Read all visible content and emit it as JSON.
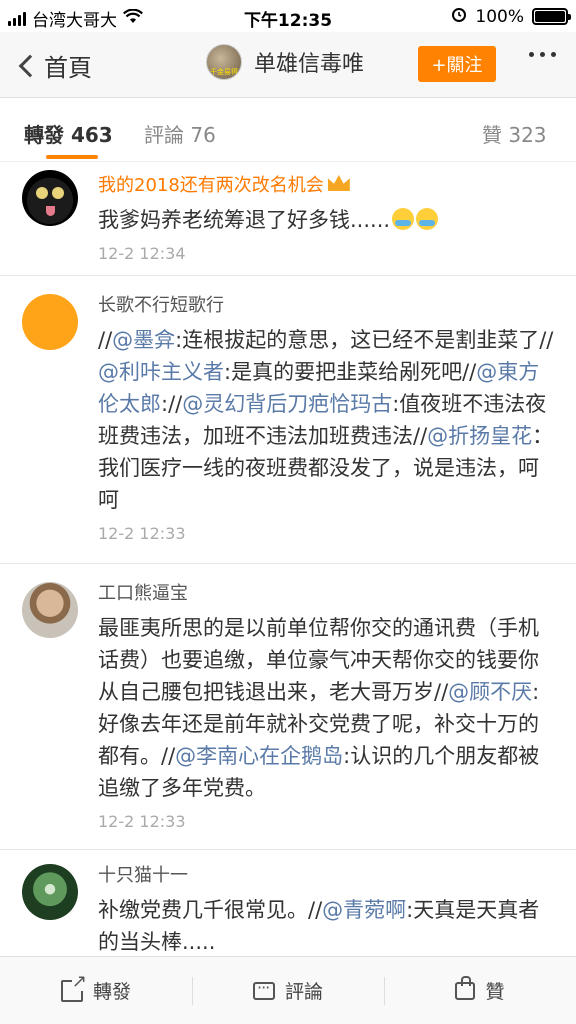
{
  "status_bar": {
    "carrier": "台湾大哥大",
    "time": "下午12:35",
    "battery": "100%"
  },
  "nav": {
    "back_label": "首頁",
    "user_name": "单雄信毒唯",
    "avatar_caption": "千金易得",
    "follow_label": "+關注"
  },
  "tabs": {
    "repost": "轉發 463",
    "comment": "評論 76",
    "like": "贊 323"
  },
  "comments": [
    {
      "user": "我的2018还有两次改名机会",
      "text": "我爹妈养老统筹退了好多钱......",
      "time": "12-2 12:34"
    },
    {
      "user": "长歌不行短歌行",
      "parts": [
        {
          "t": "//",
          "m": false
        },
        {
          "t": "@墨弇",
          "m": true
        },
        {
          "t": ":连根拔起的意思，这已经不是割韭菜了//",
          "m": false
        },
        {
          "t": "@利咔主义者",
          "m": true
        },
        {
          "t": ":是真的要把韭菜给剐死吧//",
          "m": false
        },
        {
          "t": "@東方伦太郎",
          "m": true
        },
        {
          "t": "://",
          "m": false
        },
        {
          "t": "@灵幻背后刀疤恰玛古",
          "m": true
        },
        {
          "t": ":值夜班不违法夜班费违法，加班不违法加班费违法//",
          "m": false
        },
        {
          "t": "@折扬皇花",
          "m": true
        },
        {
          "t": "：我们医疗一线的夜班费都没发了，说是违法，呵呵",
          "m": false
        }
      ],
      "time": "12-2 12:33"
    },
    {
      "user": "工口熊逼宝",
      "parts": [
        {
          "t": "最匪夷所思的是以前单位帮你交的通讯费（手机话费）也要追缴，单位豪气冲天帮你交的钱要你从自己腰包把钱退出来，老大哥万岁//",
          "m": false
        },
        {
          "t": "@顾不厌",
          "m": true
        },
        {
          "t": ":好像去年还是前年就补交党费了呢，补交十万的都有。//",
          "m": false
        },
        {
          "t": "@李南心在企鹅岛",
          "m": true
        },
        {
          "t": ":认识的几个朋友都被追缴了多年党费。",
          "m": false
        }
      ],
      "time": "12-2 12:33"
    },
    {
      "user": "十只猫十一",
      "parts": [
        {
          "t": "补缴党费几千很常见。//",
          "m": false
        },
        {
          "t": "@青菀啊",
          "m": true
        },
        {
          "t": ":天真是天真者的当头棒.....",
          "m": false
        }
      ]
    }
  ],
  "toolbar": {
    "repost": "轉發",
    "comment": "評論",
    "like": "贊"
  },
  "colors": {
    "accent": "#ff8200",
    "mention": "#5a7aa8",
    "vip_name": "#ff7a00"
  }
}
